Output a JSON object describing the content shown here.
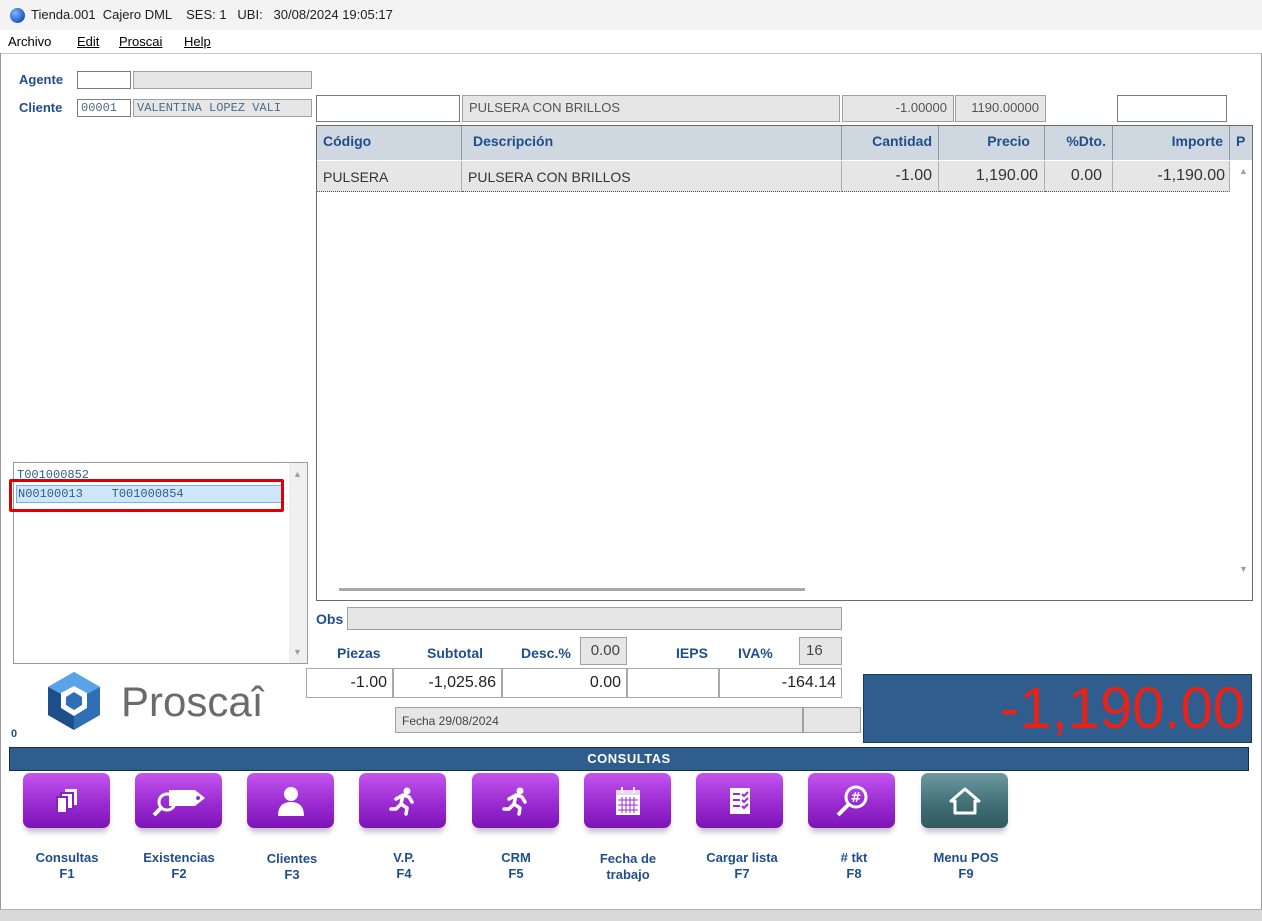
{
  "window": {
    "title": "Tienda.001  Cajero DML    SES: 1   UBI:   30/08/2024 19:05:17"
  },
  "menu": {
    "items": [
      {
        "label": "Archivo"
      },
      {
        "label": "Edit"
      },
      {
        "label": "Proscai"
      },
      {
        "label": "Help"
      }
    ]
  },
  "left": {
    "agente_label": "Agente",
    "agente_code": "",
    "agente_name": "",
    "cliente_label": "Cliente",
    "cliente_code": "00001",
    "cliente_name": "VALENTINA LOPEZ VALI",
    "tickets": [
      {
        "text": "T001000852"
      },
      {
        "text": "N00100013    T001000854"
      }
    ],
    "logo_text": "Proscaî",
    "counter": "0"
  },
  "entry": {
    "codigo": "",
    "descripcion": "PULSERA CON BRILLOS",
    "cantidad": "-1.00000",
    "precio": "1190.00000",
    "extra": ""
  },
  "grid": {
    "columns": [
      "Código",
      "Descripción",
      "Cantidad",
      "Precio",
      "%Dto.",
      "Importe",
      "P"
    ],
    "rows": [
      {
        "codigo": "PULSERA",
        "descripcion": "PULSERA CON BRILLOS",
        "cantidad": "-1.00",
        "precio": "1,190.00",
        "dto": "0.00",
        "importe": "-1,190.00"
      }
    ]
  },
  "totals": {
    "obs_label": "Obs",
    "obs_value": "",
    "piezas_label": "Piezas",
    "subtotal_label": "Subtotal",
    "desc_label": "Desc.%",
    "desc_value": "0.00",
    "ieps_label": "IEPS",
    "iva_label": "IVA%",
    "iva_value": "16",
    "piezas": "-1.00",
    "subtotal": "-1,025.86",
    "descuento": "0.00",
    "ieps": "",
    "iva": "-164.14",
    "fecha": "Fecha 29/08/2024",
    "total": "-1,190.00"
  },
  "consultas": {
    "title": "CONSULTAS",
    "buttons": [
      {
        "label1": "Consultas",
        "label2": "F1",
        "icon": "documents-icon"
      },
      {
        "label1": "Existencias",
        "label2": "F2",
        "icon": "price-tag-search-icon"
      },
      {
        "label1": "Clientes",
        "label2": "F3",
        "icon": "person-icon"
      },
      {
        "label1": "V.P.",
        "label2": "F4",
        "icon": "running-person-icon"
      },
      {
        "label1": "CRM",
        "label2": "F5",
        "icon": "running-person-icon"
      },
      {
        "label1": "Fecha de",
        "label2": "trabajo",
        "icon": "calendar-icon"
      },
      {
        "label1": "Cargar lista",
        "label2": "F7",
        "icon": "checklist-icon"
      },
      {
        "label1": "# tkt",
        "label2": "F8",
        "icon": "hash-search-icon"
      },
      {
        "label1": "Menu POS",
        "label2": "F9",
        "icon": "home-icon"
      }
    ]
  },
  "colors": {
    "accent_blue": "#2e5d8e",
    "label_blue": "#1f4e8c",
    "button_purple": "#9a2bd1",
    "button_teal": "#3f6d73",
    "total_red": "#e4241b",
    "highlight_red": "#e00000"
  }
}
